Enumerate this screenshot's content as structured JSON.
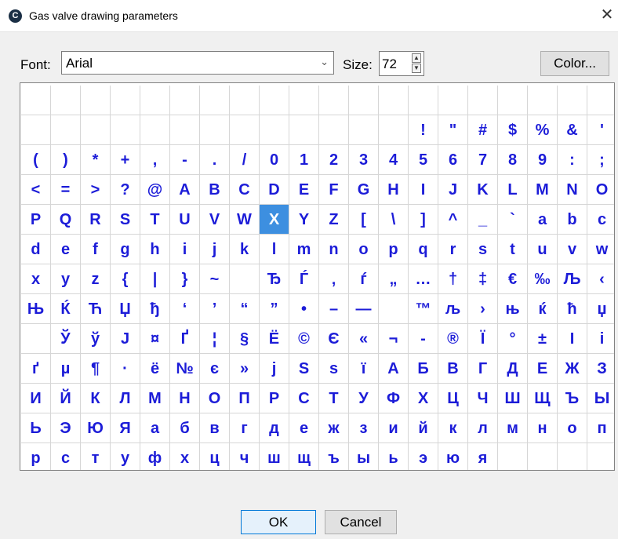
{
  "window": {
    "title": "Gas valve drawing parameters",
    "icon_letter": "C",
    "close_glyph": "✕"
  },
  "font": {
    "label": "Font:",
    "value": "Arial",
    "arrow": "⌄"
  },
  "size": {
    "label": "Size:",
    "value": "72",
    "up": "▲",
    "down": "▼"
  },
  "color_button": "Color...",
  "selected_char": "X",
  "rows": [
    [
      "",
      "",
      "",
      "",
      "",
      "",
      "",
      "",
      "",
      "",
      "",
      "",
      "",
      "",
      "",
      "",
      "",
      "",
      "",
      ""
    ],
    [
      "",
      "",
      "",
      "",
      "",
      "",
      "",
      "",
      "",
      "",
      "",
      "",
      "",
      "!",
      "\"",
      "#",
      "$",
      "%",
      "&",
      "'"
    ],
    [
      "(",
      ")",
      "*",
      "+",
      ",",
      "-",
      ".",
      "/",
      "0",
      "1",
      "2",
      "3",
      "4",
      "5",
      "6",
      "7",
      "8",
      "9",
      ":",
      ";"
    ],
    [
      "<",
      "=",
      ">",
      "?",
      "@",
      "A",
      "B",
      "C",
      "D",
      "E",
      "F",
      "G",
      "H",
      "I",
      "J",
      "K",
      "L",
      "M",
      "N",
      "O"
    ],
    [
      "P",
      "Q",
      "R",
      "S",
      "T",
      "U",
      "V",
      "W",
      "X",
      "Y",
      "Z",
      "[",
      "\\",
      "]",
      "^",
      "_",
      "`",
      "a",
      "b",
      "c"
    ],
    [
      "d",
      "e",
      "f",
      "g",
      "h",
      "i",
      "j",
      "k",
      "l",
      "m",
      "n",
      "o",
      "p",
      "q",
      "r",
      "s",
      "t",
      "u",
      "v",
      "w"
    ],
    [
      "x",
      "y",
      "z",
      "{",
      "|",
      "}",
      "~",
      "",
      "Ђ",
      "Ѓ",
      "‚",
      "ѓ",
      "„",
      "…",
      "†",
      "‡",
      "€",
      "‰",
      "Љ",
      "‹"
    ],
    [
      "Њ",
      "Ќ",
      "Ћ",
      "Џ",
      "ђ",
      "‘",
      "’",
      "“",
      "”",
      "•",
      "–",
      "—",
      "",
      "™",
      "љ",
      "›",
      "њ",
      "ќ",
      "ћ",
      "џ"
    ],
    [
      "",
      "Ў",
      "ў",
      "Ј",
      "¤",
      "Ґ",
      "¦",
      "§",
      "Ё",
      "©",
      "Є",
      "«",
      "¬",
      "-",
      "®",
      "Ї",
      "°",
      "±",
      "І",
      "і"
    ],
    [
      "ґ",
      "µ",
      "¶",
      "·",
      "ё",
      "№",
      "є",
      "»",
      "ј",
      "Ѕ",
      "ѕ",
      "ї",
      "А",
      "Б",
      "В",
      "Г",
      "Д",
      "Е",
      "Ж",
      "З"
    ],
    [
      "И",
      "Й",
      "К",
      "Л",
      "М",
      "Н",
      "О",
      "П",
      "Р",
      "С",
      "Т",
      "У",
      "Ф",
      "Х",
      "Ц",
      "Ч",
      "Ш",
      "Щ",
      "Ъ",
      "Ы"
    ],
    [
      "Ь",
      "Э",
      "Ю",
      "Я",
      "а",
      "б",
      "в",
      "г",
      "д",
      "е",
      "ж",
      "з",
      "и",
      "й",
      "к",
      "л",
      "м",
      "н",
      "о",
      "п"
    ],
    [
      "р",
      "с",
      "т",
      "у",
      "ф",
      "х",
      "ц",
      "ч",
      "ш",
      "щ",
      "ъ",
      "ы",
      "ь",
      "э",
      "ю",
      "я",
      "",
      "",
      "",
      ""
    ]
  ],
  "ok_button": "OK",
  "cancel_button": "Cancel"
}
